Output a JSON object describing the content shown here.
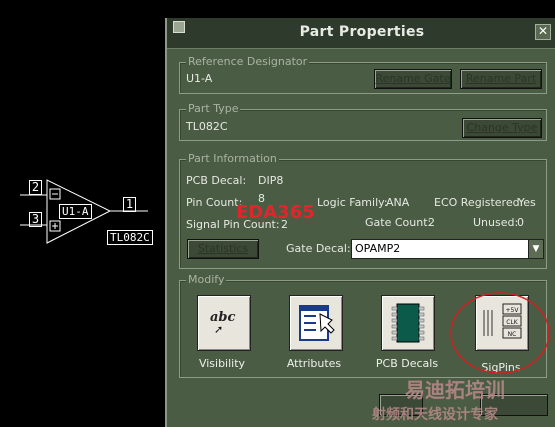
{
  "schematic": {
    "pin_inverting": "2",
    "pin_noninverting": "3",
    "pin_output": "1",
    "gate_ref": "U1-A",
    "part_name": "TL082C"
  },
  "dialog": {
    "title": "Part Properties",
    "reference_designator": {
      "group_title": "Reference Designator",
      "value": "U1-A",
      "rename_gate_button": "Rename Gate",
      "rename_part_button": "Rename Part"
    },
    "part_type": {
      "group_title": "Part Type",
      "value": "TL082C",
      "change_type_button": "Change Type"
    },
    "part_information": {
      "group_title": "Part Information",
      "pcb_decal_label": "PCB Decal:",
      "pcb_decal_value": "DIP8",
      "pin_count_label": "Pin Count:",
      "pin_count_value": "8",
      "logic_family_label": "Logic Family:",
      "logic_family_value": "ANA",
      "eco_registered_label": "ECO Registered:",
      "eco_registered_value": "Yes",
      "signal_pin_count_label": "Signal Pin Count:",
      "signal_pin_count_value": "2",
      "gate_count_label": "Gate Count:",
      "gate_count_value": "2",
      "unused_label": "Unused:",
      "unused_value": "0",
      "statistics_button": "Statistics",
      "gate_decal_label": "Gate Decal:",
      "gate_decal_value": "OPAMP2"
    },
    "modify": {
      "group_title": "Modify",
      "visibility": "Visibility",
      "attributes": "Attributes",
      "pcb_decals": "PCB Decals",
      "sigpins": "SigPins",
      "visibility_glyph": "abc",
      "sigpins_tags": [
        "+5V",
        "CLK",
        "NC"
      ]
    }
  },
  "watermarks": {
    "eda": "EDA365",
    "cn_top": "易迪拓培训",
    "cn_bottom": "射频和天线设计专家"
  },
  "colors": {
    "dialog_bg": "#4b5c44",
    "titlebar_bg": "#2e3a2b",
    "highlight_circle": "#d02020",
    "watermark_red": "#e0262c"
  }
}
